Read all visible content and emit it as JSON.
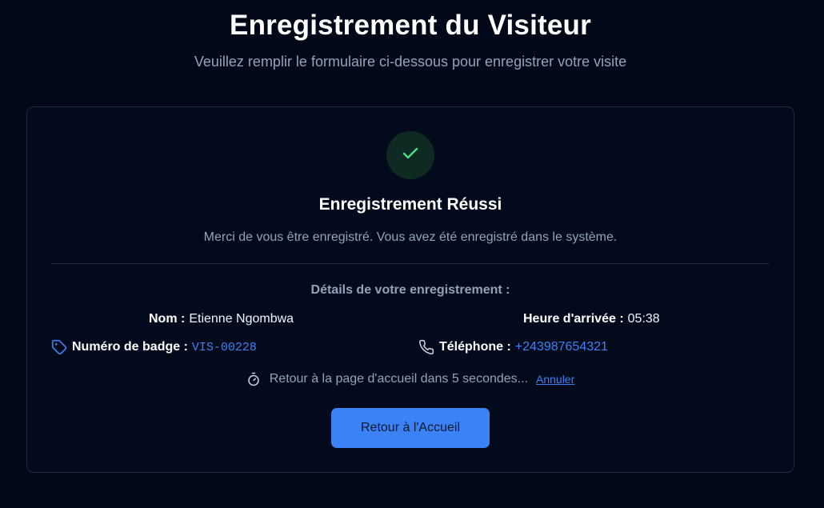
{
  "header": {
    "title": "Enregistrement du Visiteur",
    "subtitle": "Veuillez remplir le formulaire ci-dessous pour enregistrer votre visite"
  },
  "success": {
    "icon": "check-icon",
    "title": "Enregistrement Réussi",
    "message": "Merci de vous être enregistré. Vous avez été enregistré dans le système."
  },
  "details": {
    "heading": "Détails de votre enregistrement :",
    "name_label": "Nom :",
    "name_value": "Etienne Ngombwa",
    "arrival_label": "Heure d'arrivée :",
    "arrival_value": "05:38",
    "badge_icon": "tag-icon",
    "badge_label": "Numéro de badge :",
    "badge_value": "VIS-00228",
    "phone_icon": "phone-icon",
    "phone_label": "Téléphone :",
    "phone_value": "+243987654321"
  },
  "redirect": {
    "icon": "timer-icon",
    "text": "Retour à la page d'accueil dans 5 secondes...",
    "cancel_label": "Annuler"
  },
  "actions": {
    "home_label": "Retour à l'Accueil"
  },
  "colors": {
    "background": "#020817",
    "accent": "#3b82f6",
    "success": "#4ade80",
    "muted": "#94a3b8"
  }
}
